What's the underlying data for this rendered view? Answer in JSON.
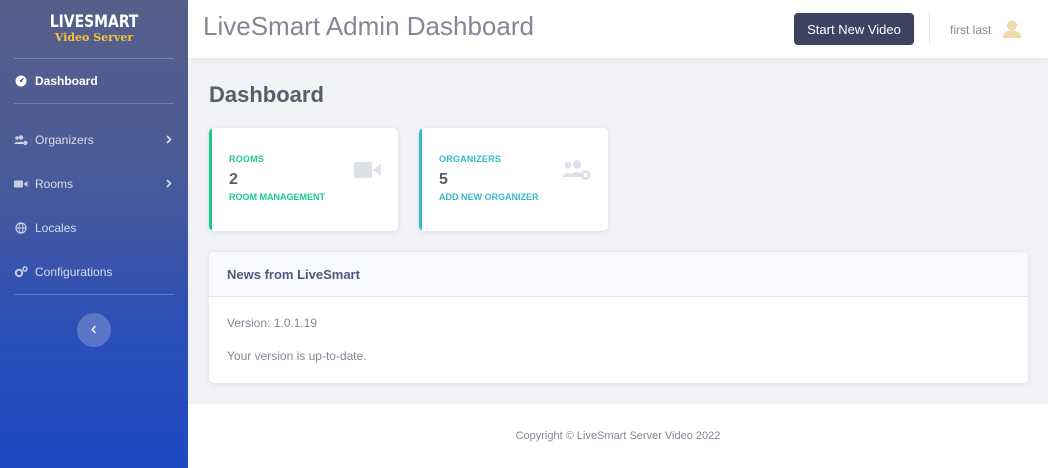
{
  "brand": {
    "title": "LIVESMART",
    "subtitle": "Video Server"
  },
  "sidebar": {
    "items": [
      {
        "label": "Dashboard",
        "icon": "tachometer-icon"
      },
      {
        "label": "Organizers",
        "icon": "users-cog-icon"
      },
      {
        "label": "Rooms",
        "icon": "video-icon"
      },
      {
        "label": "Locales",
        "icon": "globe-icon"
      },
      {
        "label": "Configurations",
        "icon": "cogs-icon"
      }
    ],
    "toggle_icon": "chevron-left-icon"
  },
  "topbar": {
    "title": "LiveSmart Admin Dashboard",
    "start_button": "Start New Video",
    "user_name": "first last"
  },
  "page": {
    "title": "Dashboard"
  },
  "cards": {
    "rooms": {
      "label": "ROOMS",
      "value": "2",
      "link": "ROOM MANAGEMENT",
      "icon": "video-icon"
    },
    "organizers": {
      "label": "ORGANIZERS",
      "value": "5",
      "link": "ADD NEW ORGANIZER",
      "icon": "users-cog-icon"
    }
  },
  "news": {
    "title": "News from LiveSmart",
    "version": "Version: 1.0.1.19",
    "status": "Your version is up-to-date."
  },
  "footer": {
    "text": "Copyright © LiveSmart Server Video 2022"
  },
  "colors": {
    "rooms_accent": "#1cc88a",
    "organizers_accent": "#36b9cc",
    "button": "#3d4260"
  }
}
